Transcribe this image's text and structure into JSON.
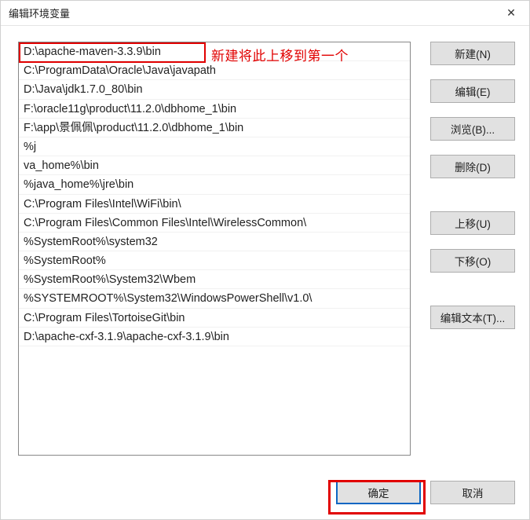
{
  "title": "编辑环境变量",
  "close_glyph": "✕",
  "annotation": "新建将此上移到第一个",
  "list": {
    "items": [
      "D:\\apache-maven-3.3.9\\bin",
      "C:\\ProgramData\\Oracle\\Java\\javapath",
      "D:\\Java\\jdk1.7.0_80\\bin",
      "F:\\oracle11g\\product\\11.2.0\\dbhome_1\\bin",
      "F:\\app\\景佩佩\\product\\11.2.0\\dbhome_1\\bin",
      "%j",
      "va_home%\\bin",
      "%java_home%\\jre\\bin",
      "C:\\Program Files\\Intel\\WiFi\\bin\\",
      "C:\\Program Files\\Common Files\\Intel\\WirelessCommon\\",
      "%SystemRoot%\\system32",
      "%SystemRoot%",
      "%SystemRoot%\\System32\\Wbem",
      "%SYSTEMROOT%\\System32\\WindowsPowerShell\\v1.0\\",
      "C:\\Program Files\\TortoiseGit\\bin",
      "D:\\apache-cxf-3.1.9\\apache-cxf-3.1.9\\bin"
    ]
  },
  "buttons": {
    "new": "新建(N)",
    "edit": "编辑(E)",
    "browse": "浏览(B)...",
    "delete": "删除(D)",
    "move_up": "上移(U)",
    "move_down": "下移(O)",
    "edit_text": "编辑文本(T)...",
    "ok": "确定",
    "cancel": "取消"
  }
}
